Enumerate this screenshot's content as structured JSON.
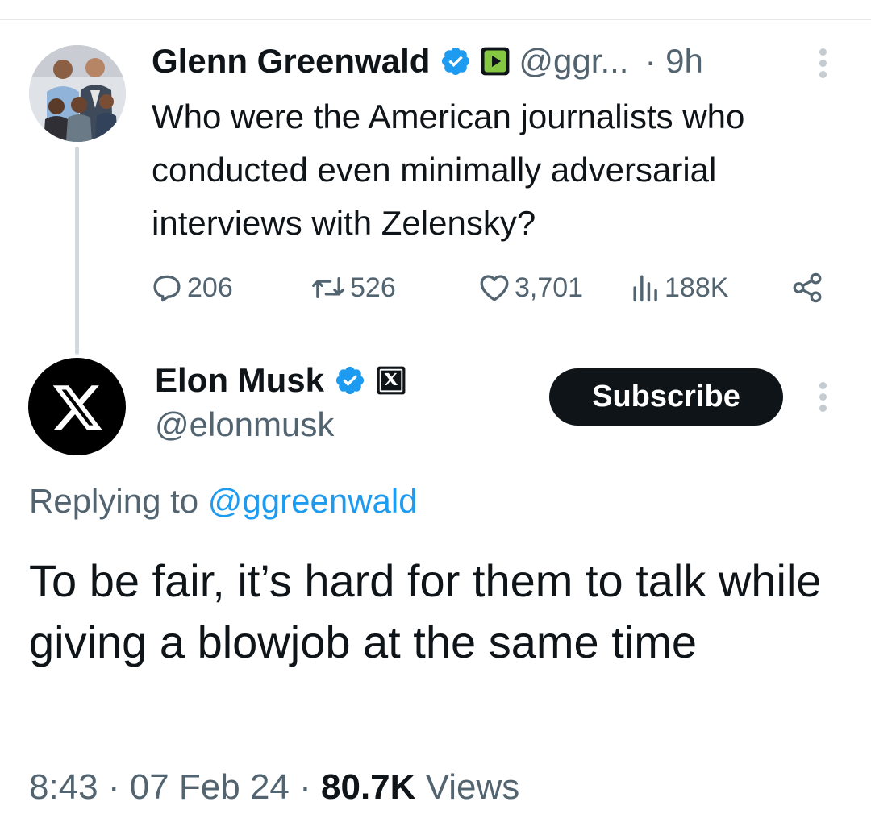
{
  "parent_tweet": {
    "author_name": "Glenn Greenwald",
    "handle_truncated": "@ggr...",
    "time_ago": "· 9h",
    "text": "Who were the American journalists who conducted even minimally adversarial interviews with Zelensky?",
    "stats": {
      "replies": "206",
      "retweets": "526",
      "likes": "3,701",
      "views": "188K"
    },
    "icons": [
      "verified-badge-icon",
      "rumble-icon",
      "more-options-icon",
      "reply-icon",
      "retweet-icon",
      "like-icon",
      "views-icon",
      "share-icon"
    ]
  },
  "reply_tweet": {
    "author_name": "Elon Musk",
    "handle": "@elonmusk",
    "subscribe_label": "Subscribe",
    "replying_prefix": "Replying to",
    "replying_handle": "@ggreenwald",
    "text": "To be fair, it’s hard for them to talk while giving a blowjob at the same time",
    "time": "8:43",
    "date": "· 07 Feb 24 ·",
    "views_count": "80.7K",
    "views_label": "Views",
    "icons": [
      "x-logo-icon",
      "verified-badge-icon",
      "x-affiliate-badge-icon",
      "more-options-icon"
    ]
  },
  "colors": {
    "text_primary": "#0f1419",
    "text_secondary": "#536471",
    "link_blue": "#1d9bf0",
    "verified_blue": "#1d9bf0",
    "rumble_green": "#85c742",
    "thread_line": "#cfd9de"
  }
}
